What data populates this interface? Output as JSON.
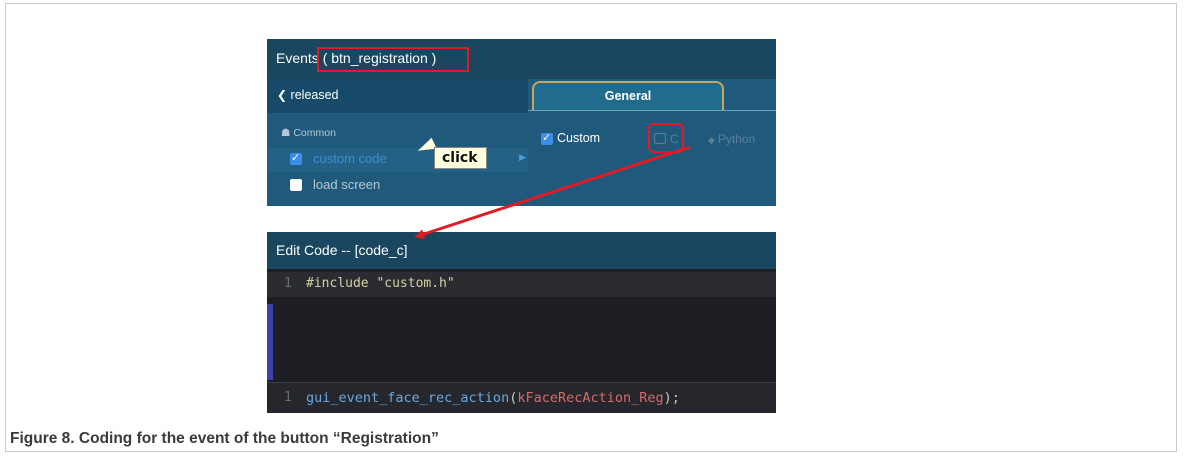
{
  "events_panel": {
    "title_prefix": "Events",
    "title_target": "( btn_registration )",
    "back_label": "released",
    "back_icon": "chevron-left-icon",
    "section_label": "Common",
    "section_icon": "user-group-icon",
    "items": [
      {
        "label": "custom code",
        "checked": true,
        "selected": true
      },
      {
        "label": "load screen",
        "checked": false,
        "selected": false
      }
    ],
    "tab_label": "General",
    "custom_label": "Custom",
    "custom_checked": true,
    "lang_c": "C",
    "lang_python": "Python",
    "tooltip": "click"
  },
  "code_panel": {
    "title": "Edit Code -- [code_c]",
    "line1_num": "1",
    "line1_code": "#include \"custom.h\"",
    "line2_num": "1",
    "line2_fn": "gui_event_face_rec_action",
    "line2_open": "(",
    "line2_arg": "kFaceRecAction_Reg",
    "line2_close": ");"
  },
  "caption": "Figure 8.  Coding for the event of the button “Registration”",
  "colors": {
    "accent_red": "#e01b24",
    "panel_blue": "#1f5a7c",
    "title_blue": "#1a4660",
    "editor_bg": "#1e1f24",
    "tab_border": "#c9a65b"
  }
}
